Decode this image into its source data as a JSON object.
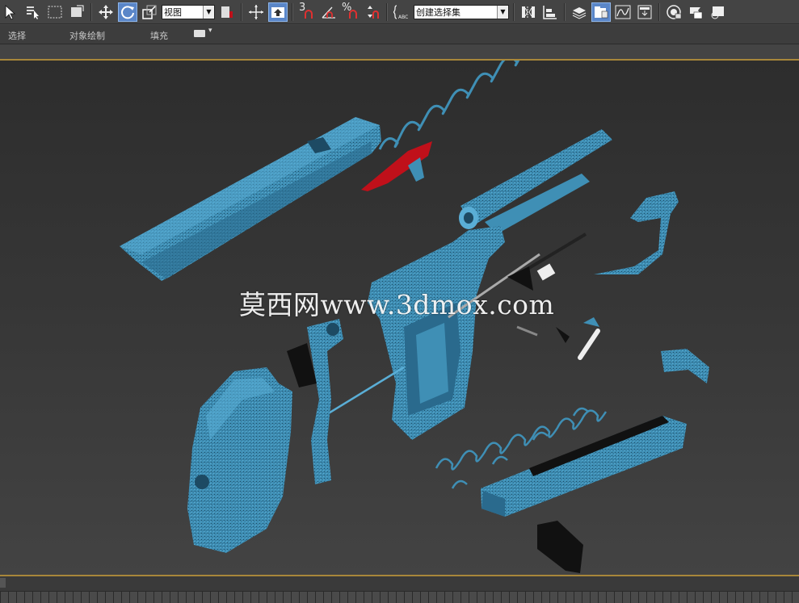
{
  "toolbar": {
    "view_dropdown": "视图",
    "selection_set_dropdown": "创建选择集",
    "snap_label": "3",
    "percent_label": "%"
  },
  "ribbon": {
    "tab_select": "选择",
    "tab_object_paint": "对象绘制",
    "tab_populate": "填充"
  },
  "viewport": {
    "watermark": "莫西网www.3dmox.com"
  },
  "colors": {
    "model_blue": "#3f8fb5",
    "accent_red": "#c0101a",
    "active_button": "#5a86c8",
    "separator_gold": "#a8873a"
  }
}
